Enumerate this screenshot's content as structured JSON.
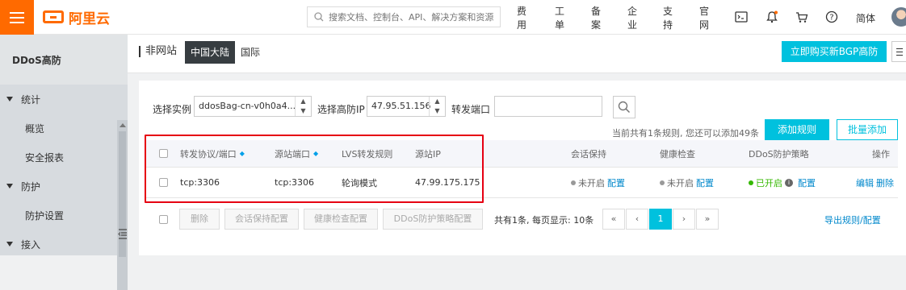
{
  "topbar": {
    "brand": "阿里云",
    "search_placeholder": "搜索文档、控制台、API、解决方案和资源",
    "nav": [
      "费用",
      "工单",
      "备案",
      "企业",
      "支持",
      "官网"
    ],
    "lang": "简体"
  },
  "sidebar": {
    "product": "DDoS高防",
    "groups": [
      {
        "label": "统计",
        "items": [
          "概览",
          "安全报表"
        ]
      },
      {
        "label": "防护",
        "items": [
          "防护设置"
        ]
      },
      {
        "label": "接入",
        "items": []
      }
    ]
  },
  "header": {
    "crumb": "非网站",
    "tabs": [
      "中国大陆",
      "国际"
    ],
    "buy_label": "立即购买新BGP高防"
  },
  "filter": {
    "instance_label": "选择实例",
    "instance_value": "ddosBag-cn-v0h0a4...",
    "ip_label": "选择高防IP",
    "ip_value": "47.95.51.156",
    "port_label": "转发端口",
    "port_value": ""
  },
  "summary": {
    "hint": "当前共有1条规则, 您还可以添加49条",
    "add_label": "添加规则",
    "batch_label": "批量添加"
  },
  "table": {
    "headers": [
      "转发协议/端口",
      "源站端口",
      "LVS转发规则",
      "源站IP",
      "会话保持",
      "健康检查",
      "DDoS防护策略",
      "操作"
    ],
    "rows": [
      {
        "protocol_port": "tcp:3306",
        "origin_port": "tcp:3306",
        "lvs_rule": "轮询模式",
        "origin_ip": "47.99.175.175",
        "session": "未开启",
        "session_link": "配置",
        "health": "未开启",
        "health_link": "配置",
        "ddos": "已开启",
        "ddos_link": "配置",
        "edit": "编辑",
        "delete": "删除"
      }
    ]
  },
  "footer": {
    "buttons": [
      "删除",
      "会话保持配置",
      "健康检查配置",
      "DDoS防护策略配置"
    ],
    "page_info": "共有1条, 每页显示: 10条",
    "pager": [
      "«",
      "‹",
      "1",
      "›",
      "»"
    ],
    "export": "导出规则/配置"
  }
}
